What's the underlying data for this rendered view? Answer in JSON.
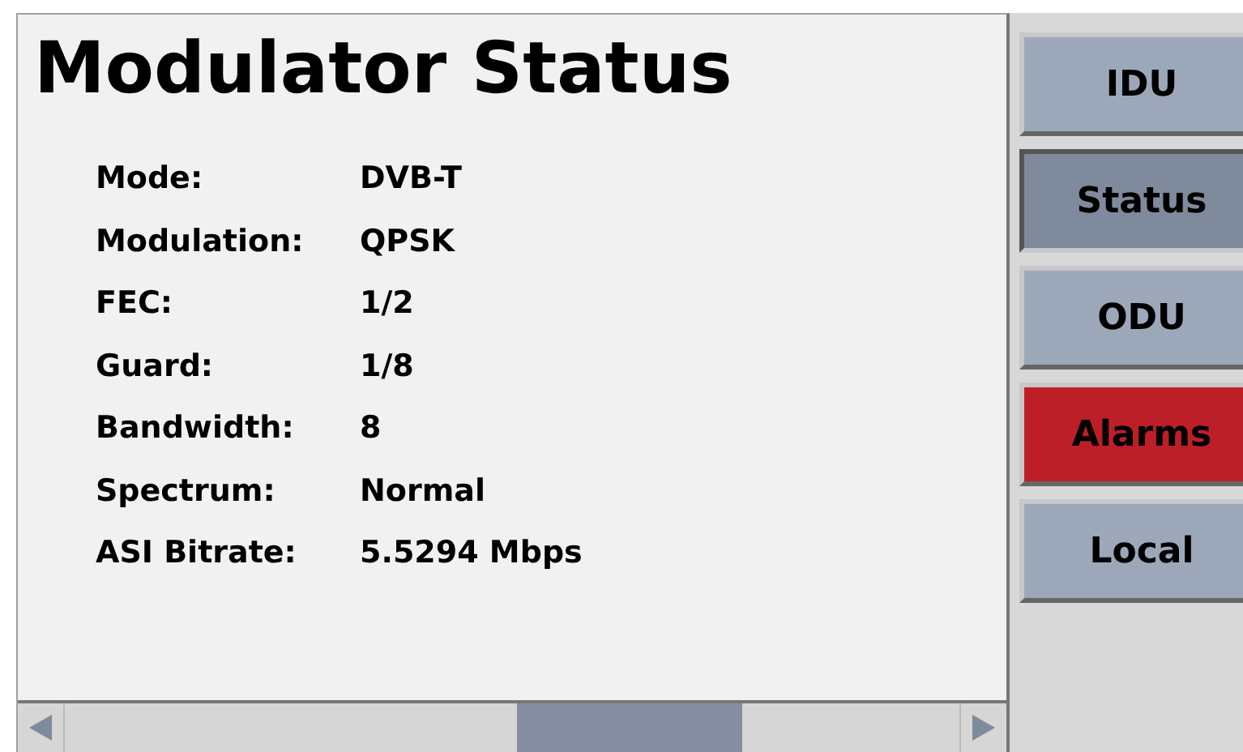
{
  "title": "Modulator Status",
  "fields": [
    {
      "label": "Mode:",
      "value": "DVB-T"
    },
    {
      "label": "Modulation:",
      "value": "QPSK"
    },
    {
      "label": "FEC:",
      "value": "1/2"
    },
    {
      "label": "Guard:",
      "value": "1/8"
    },
    {
      "label": "Bandwidth:",
      "value": "8"
    },
    {
      "label": "Spectrum:",
      "value": "Normal"
    },
    {
      "label": "ASI Bitrate:",
      "value": "5.5294 Mbps"
    }
  ],
  "nav": [
    {
      "label": "IDU",
      "selected": false,
      "kind": "normal"
    },
    {
      "label": "Status",
      "selected": true,
      "kind": "normal"
    },
    {
      "label": "ODU",
      "selected": false,
      "kind": "normal"
    },
    {
      "label": "Alarms",
      "selected": false,
      "kind": "alarm"
    },
    {
      "label": "Local",
      "selected": false,
      "kind": "normal"
    }
  ]
}
